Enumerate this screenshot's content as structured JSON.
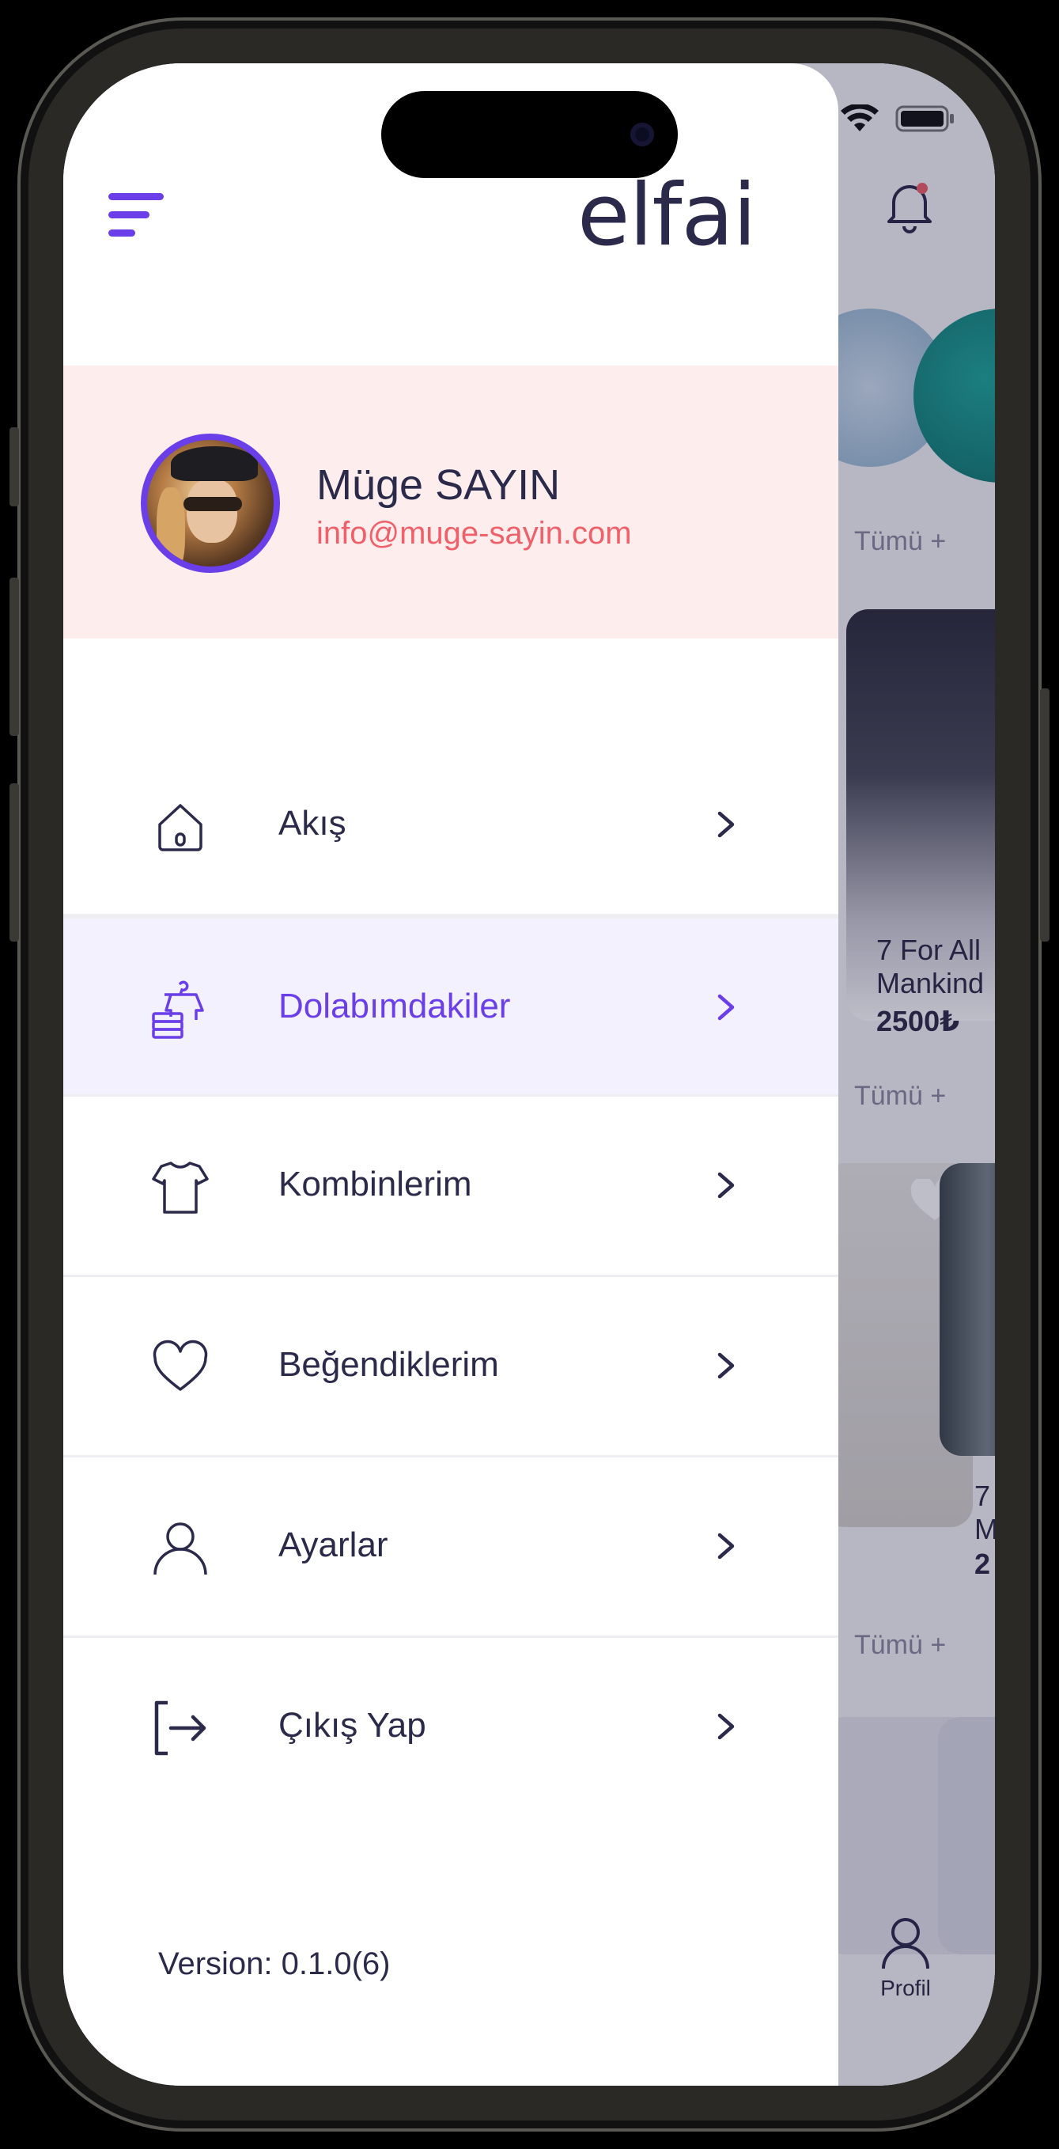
{
  "app": {
    "logo": "elfai"
  },
  "profile": {
    "name": "Müge SAYIN",
    "email": "info@muge-sayin.com"
  },
  "menu": {
    "items": [
      {
        "label": "Akış",
        "icon": "home-icon",
        "active": false
      },
      {
        "label": "Dolabımdakiler",
        "icon": "wardrobe-icon",
        "active": true
      },
      {
        "label": "Kombinlerim",
        "icon": "tshirt-icon",
        "active": false
      },
      {
        "label": "Beğendiklerim",
        "icon": "heart-icon",
        "active": false
      },
      {
        "label": "Ayarlar",
        "icon": "user-icon",
        "active": false
      },
      {
        "label": "Çıkış Yap",
        "icon": "logout-icon",
        "active": false
      }
    ]
  },
  "version": "Version: 0.1.0(6)",
  "background": {
    "see_all_1": "Tümü +",
    "see_all_2": "Tümü +",
    "see_all_3": "Tümü +",
    "product_title_line1": "7 For All",
    "product_title_line2": "Mankind",
    "product_price": "2500₺",
    "product2_line1": "7",
    "product2_line2": "M",
    "product2_price": "2",
    "profile_tab": "Profil"
  },
  "colors": {
    "accent": "#6a3ee8",
    "email": "#f0606a",
    "text": "#2b2a4a",
    "profile_bg": "#fdeeed",
    "active_bg": "#f3f1fd"
  }
}
